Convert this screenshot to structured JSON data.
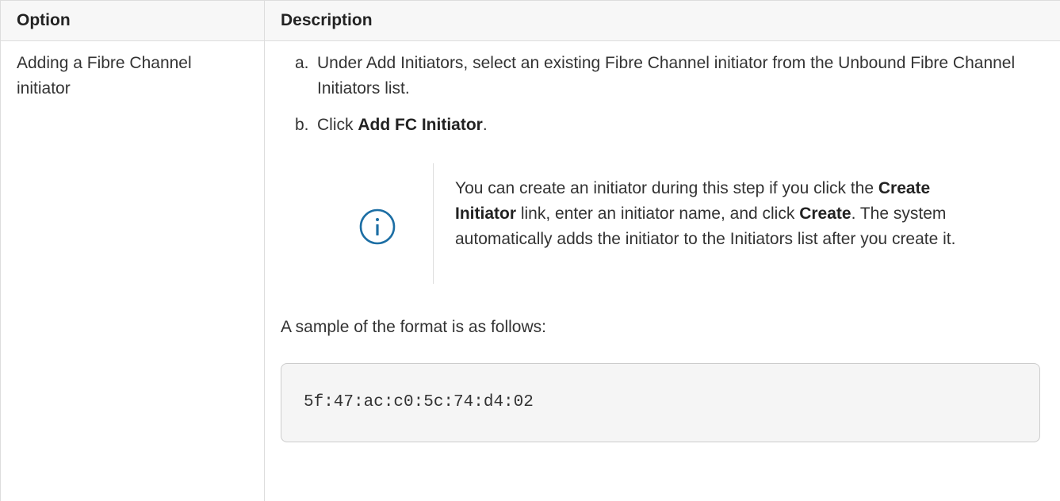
{
  "table": {
    "headers": [
      "Option",
      "Description"
    ],
    "row": {
      "option": "Adding a Fibre Channel initiator",
      "steps": [
        {
          "marker": "a.",
          "text": "Under Add Initiators, select an existing Fibre Channel initiator from the Unbound Fibre Channel Initiators list."
        },
        {
          "marker": "b.",
          "prefix": "Click ",
          "bold": "Add FC Initiator",
          "suffix": "."
        }
      ],
      "note": {
        "icon": "info-icon",
        "part1": "You can create an initiator during this step if you click the ",
        "bold1": "Create Initiator",
        "part2": " link, enter an initiator name, and click ",
        "bold2": "Create",
        "part3": ". The system automatically adds the initiator to the Initiators list after you create it."
      },
      "sample_intro": "A sample of the format is as follows:",
      "sample_code": "5f:47:ac:c0:5c:74:d4:02"
    }
  },
  "colors": {
    "info_icon": "#1c6ea4",
    "border": "#dddddd",
    "header_bg": "#f7f7f7",
    "code_bg": "#f5f5f5"
  }
}
